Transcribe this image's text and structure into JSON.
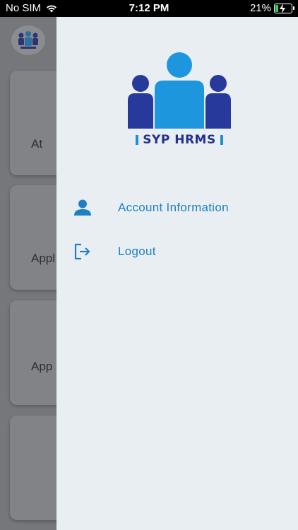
{
  "status_bar": {
    "carrier": "No SIM",
    "time": "7:12 PM",
    "battery_percent": "21%",
    "battery_level": 0.21,
    "wifi_icon": "wifi-icon",
    "battery_icon": "battery-charging-icon"
  },
  "background_app": {
    "cards": [
      {
        "label": "At"
      },
      {
        "label": "Appl"
      },
      {
        "label": "App"
      },
      {
        "label": ""
      }
    ]
  },
  "drawer": {
    "brand_text": "SYP HRMS",
    "brand_colors": {
      "dark": "#23318c",
      "light": "#1f8fd6"
    },
    "menu": [
      {
        "label": "Account Information",
        "icon": "person-icon"
      },
      {
        "label": "Logout",
        "icon": "logout-icon"
      }
    ],
    "accent_color": "#1f7fc4",
    "background_color": "#e9eef2"
  }
}
